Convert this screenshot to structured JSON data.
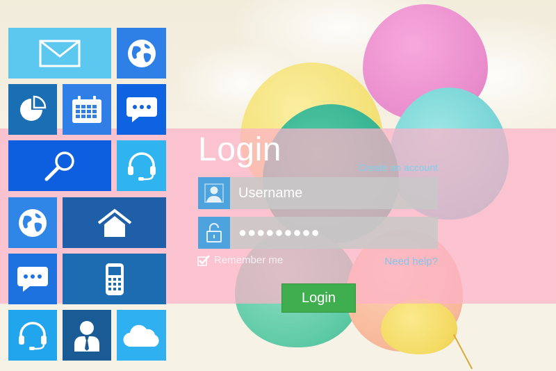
{
  "login": {
    "title": "Login",
    "create_account": "Create an account",
    "username_placeholder": "Username",
    "password_mask": "●●●●●●●●●",
    "remember_me": "Remember me",
    "remember_checked": true,
    "need_help": "Need help?",
    "button_label": "Login"
  },
  "tiles": [
    {
      "icon": "mail-icon",
      "color": "#5cc8f0"
    },
    {
      "icon": "globe-icon",
      "color": "#2f80e6"
    },
    {
      "icon": "pie-chart-icon",
      "color": "#1a6fb4"
    },
    {
      "icon": "calendar-icon",
      "color": "#2f7fe6"
    },
    {
      "icon": "chat-icon",
      "color": "#0d63e0"
    },
    {
      "icon": "search-icon",
      "color": "#0d5fe0"
    },
    {
      "icon": "headset-icon",
      "color": "#2fb4f0"
    },
    {
      "icon": "globe-icon",
      "color": "#2f86e6"
    },
    {
      "icon": "home-icon",
      "color": "#1e5fa8"
    },
    {
      "icon": "chat-icon",
      "color": "#1e72e0"
    },
    {
      "icon": "phone-icon",
      "color": "#1d6bb0"
    },
    {
      "icon": "headset-icon",
      "color": "#21a6ee"
    },
    {
      "icon": "user-icon",
      "color": "#1a5a95"
    },
    {
      "icon": "cloud-icon",
      "color": "#2fb0f0"
    }
  ],
  "colors": {
    "band": "#fcb2c8",
    "field_icon_bg": "#4da3dd",
    "button": "#3fae4f",
    "link": "#7fd0ee"
  }
}
